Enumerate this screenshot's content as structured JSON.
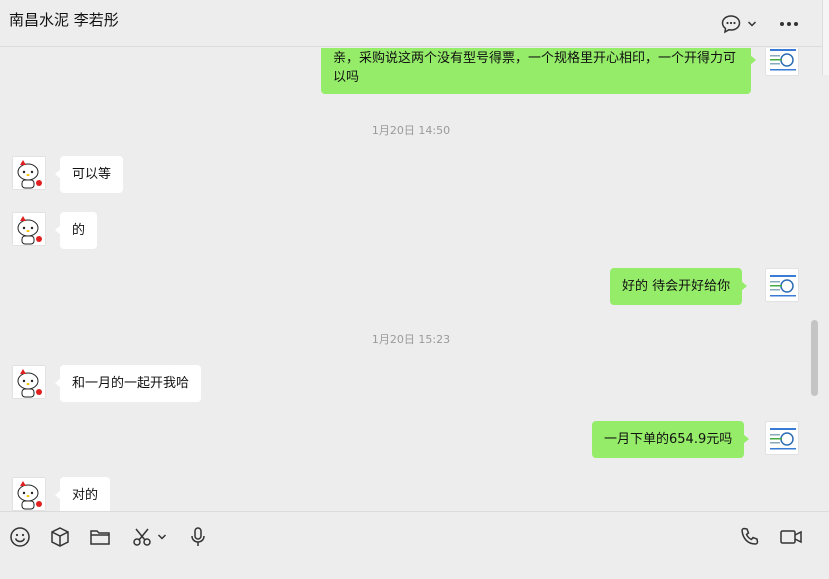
{
  "header": {
    "title": "南昌水泥 李若彤"
  },
  "messages": [
    {
      "text": "亲，采购说这两个没有型号得票，一个规格里开心相印，一个开得力可以吗"
    },
    {
      "time": "1月20日 14:50"
    },
    {
      "text": "可以等"
    },
    {
      "text": "的"
    },
    {
      "text": "好的 待会开好给你"
    },
    {
      "time": "1月20日 15:23"
    },
    {
      "text": "和一月的一起开我哈"
    },
    {
      "text": "一月下单的654.9元吗"
    },
    {
      "text": "对的"
    }
  ],
  "icons": {
    "header": [
      "chat-bubble-icon",
      "chevron-down-icon",
      "more-icon"
    ],
    "toolbar_left": [
      "emoji-icon",
      "box-icon",
      "folder-icon",
      "scissors-icon",
      "chevron-down-icon",
      "microphone-icon"
    ],
    "toolbar_right": [
      "phone-icon",
      "video-icon"
    ]
  },
  "colors": {
    "outgoing_bubble": "#95ec69",
    "incoming_bubble": "#ffffff",
    "background": "#ededed"
  }
}
